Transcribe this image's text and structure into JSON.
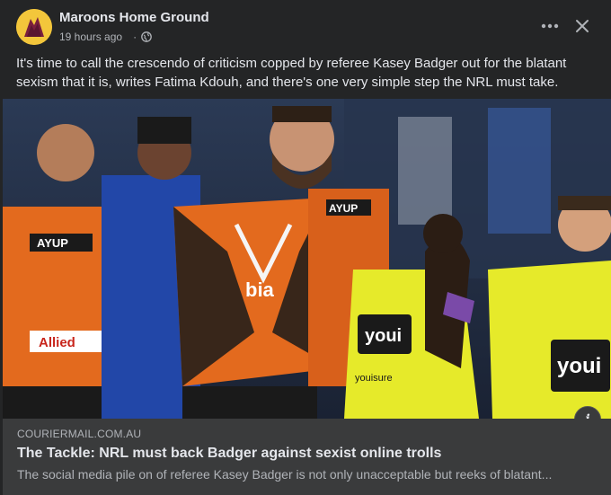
{
  "post": {
    "page_name": "Maroons Home Ground",
    "timestamp": "19 hours ago",
    "separator": "·",
    "privacy_icon": "globe-icon",
    "caption": "It's time to call the crescendo of criticism copped by referee Kasey Badger out for the blatant sexism that it is, writes Fatima Kdouh, and there's one very simple step the NRL must take."
  },
  "header_actions": {
    "more_icon": "more-horizontal-icon",
    "close_icon": "close-icon"
  },
  "photo": {
    "info_icon": "info-icon",
    "info_label": "i",
    "jersey_text": {
      "left_number": "AYUP",
      "left_sponsor": "Allied",
      "right_top": "AYUP",
      "chest_sponsor": "bia",
      "ref_logo_1": "youi",
      "ref_logo_2": "youi",
      "ref_sleeve": "youisure"
    }
  },
  "link_preview": {
    "domain": "COURIERMAIL.COM.AU",
    "title": "The Tackle: NRL must back Badger against sexist online trolls",
    "description": "The social media pile on of referee Kasey Badger is not only unacceptable but reeks of blatant..."
  },
  "colors": {
    "background": "#242526",
    "preview_bg": "#3a3b3c",
    "text_primary": "#e4e6eb",
    "text_secondary": "#b0b3b8",
    "avatar_bg": "#f3c63b",
    "avatar_maroon": "#7a1f3d"
  }
}
